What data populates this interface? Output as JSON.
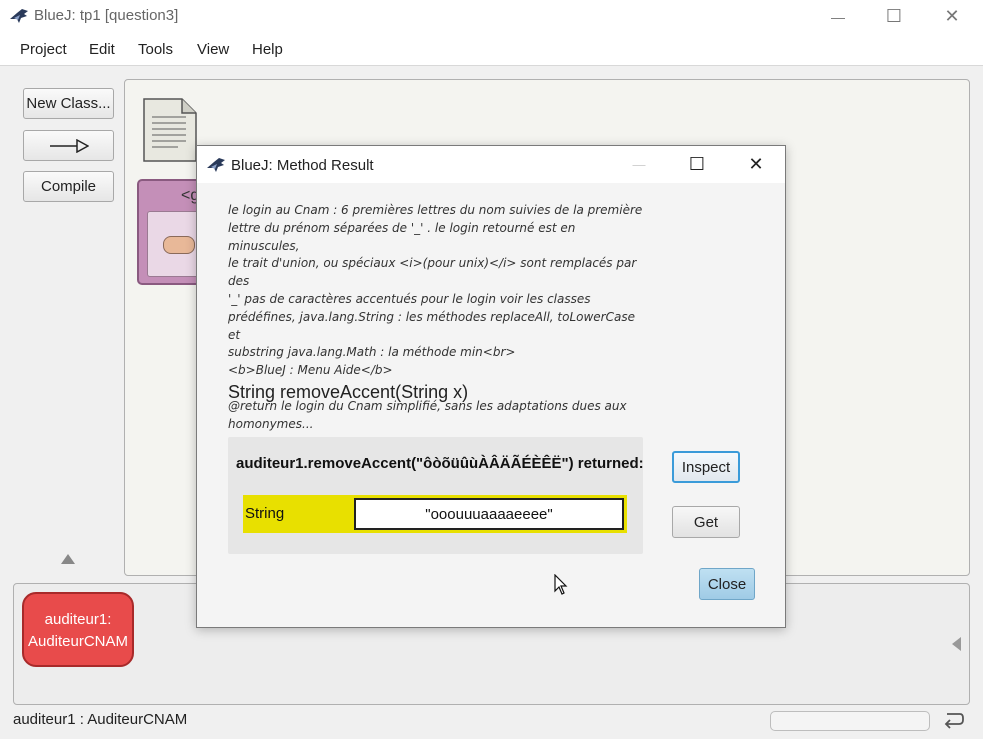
{
  "main_window": {
    "title": "BlueJ:  tp1  [question3]",
    "controls": {
      "minimize": "—",
      "maximize": "☐",
      "close": "✕"
    }
  },
  "menu": [
    {
      "id": "project",
      "label": "Project"
    },
    {
      "id": "edit",
      "label": "Edit"
    },
    {
      "id": "tools",
      "label": "Tools"
    },
    {
      "id": "view",
      "label": "View"
    },
    {
      "id": "help",
      "label": "Help"
    }
  ],
  "toolbar": {
    "new_class": "New Class...",
    "compile": "Compile"
  },
  "class_diagram": {
    "class_stereotype": "<g"
  },
  "object_bench": {
    "object_line1": "auditeur1:",
    "object_line2": "AuditeurCNAM"
  },
  "status_bar": {
    "text": "auditeur1 : AuditeurCNAM"
  },
  "dialog": {
    "title": "BlueJ:  Method Result",
    "controls": {
      "minimize": "—",
      "maximize": "☐",
      "close": "✕"
    },
    "doc_comment": "le login au Cnam : 6 premières lettres du nom suivies de la première\nlettre du prénom séparées de '_' . le login retourné est en minuscules,\nle trait d'union, ou spéciaux <i>(pour unix)</i> sont remplacés par des\n'_' pas de caractères accentués pour le login voir les classes\nprédéfines, java.lang.String : les méthodes replaceAll, toLowerCase et\nsubstring java.lang.Math : la méthode min<br>\n<b>BlueJ : Menu Aide</b>\n\n@return le login du Cnam simplifié, sans les adaptations dues aux\nhomonymes...",
    "signature": "String removeAccent(String x)",
    "result_label": "auditeur1.removeAccent(\"ôòõüûùÀÂÄÃÉÈÊË\") returned:",
    "result_type": "String",
    "result_value": "\"ooouuuaaaaeeee\"",
    "buttons": {
      "inspect": "Inspect",
      "get": "Get",
      "close": "Close"
    }
  }
}
